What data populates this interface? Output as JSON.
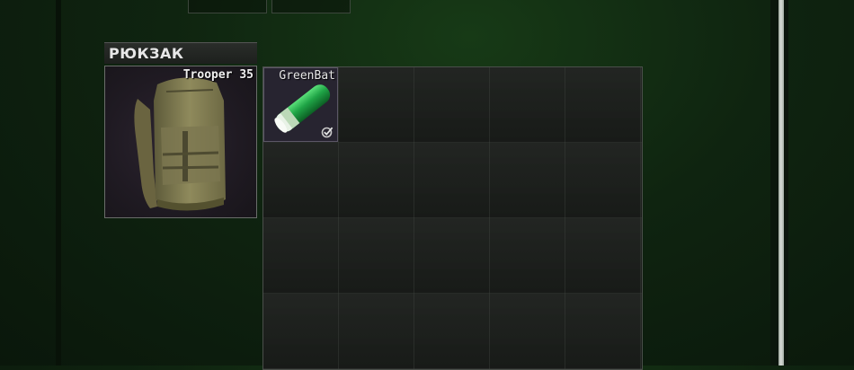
{
  "backpack_section": {
    "title": "РЮКЗАК",
    "equipped_item": {
      "name": "Trooper 35",
      "icon": "backpack-icon"
    }
  },
  "backpack_grid": {
    "columns": 5,
    "rows_visible": 4,
    "items": [
      {
        "name": "GreenBat",
        "icon": "green-battery-icon",
        "status_icon": "examined-check-icon"
      }
    ]
  },
  "colors": {
    "background": "#0f2410",
    "header_text": "#e7e7e7",
    "item_background": "#272430",
    "battery_green": "#1fa446"
  }
}
